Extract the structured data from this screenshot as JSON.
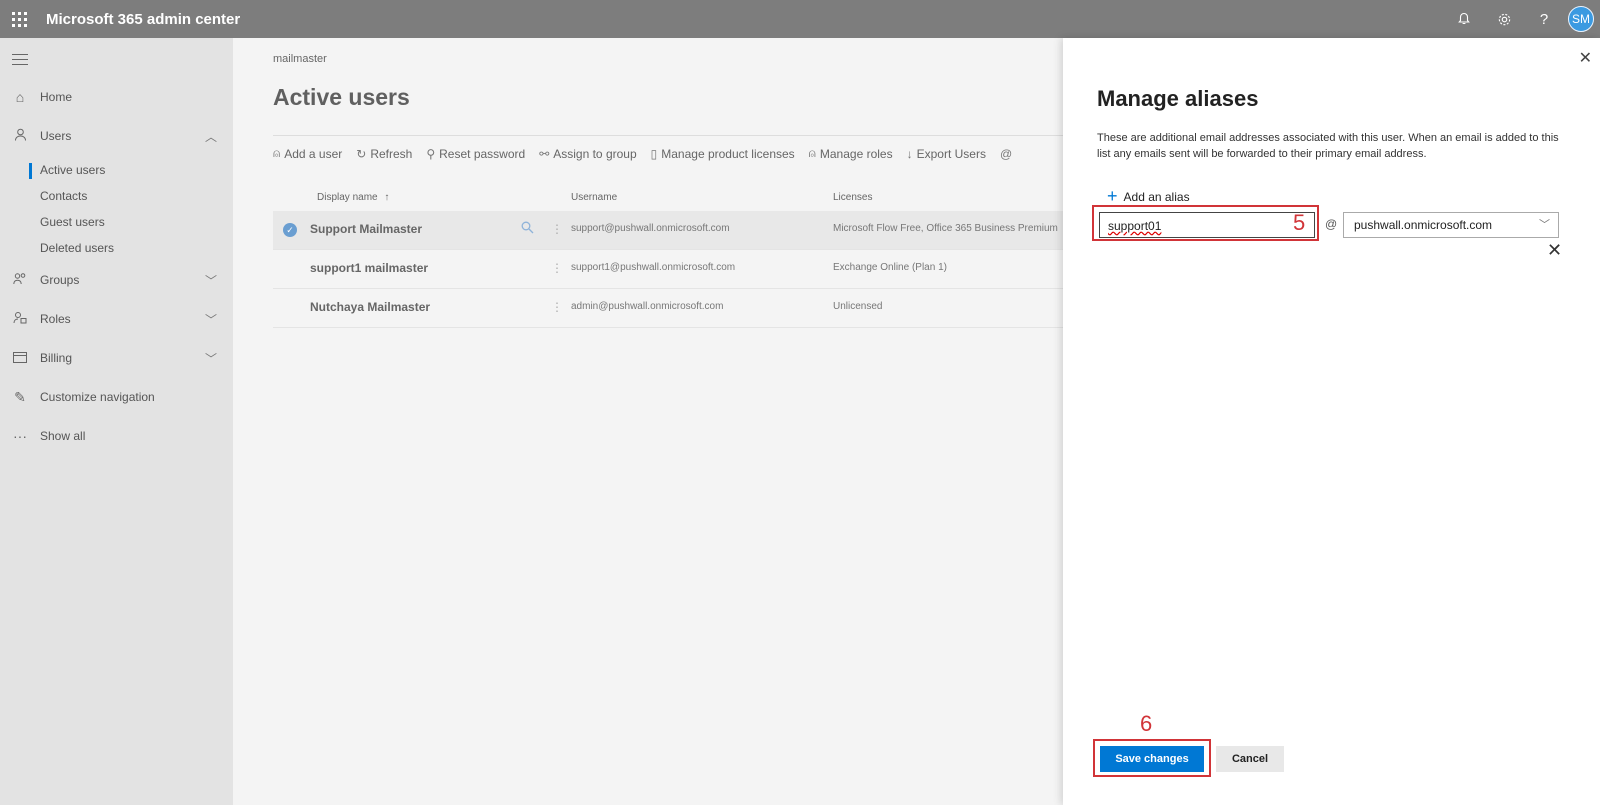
{
  "app": {
    "title": "Microsoft 365 admin center",
    "avatar_initials": "SM"
  },
  "topbar": {
    "icons": [
      "bell-icon",
      "gear-icon",
      "help-icon"
    ]
  },
  "nav": {
    "items": [
      {
        "label": "Home",
        "icon": "home-icon"
      },
      {
        "label": "Users",
        "icon": "user-icon"
      },
      {
        "label": "Groups",
        "icon": "groups-icon"
      },
      {
        "label": "Roles",
        "icon": "roles-icon"
      },
      {
        "label": "Billing",
        "icon": "billing-icon"
      },
      {
        "label": "Customize navigation",
        "icon": "pencil-icon"
      },
      {
        "label": "Show all",
        "icon": "ellipsis-icon"
      }
    ],
    "user_subitems": [
      "Active users",
      "Contacts",
      "Guest users",
      "Deleted users"
    ]
  },
  "main": {
    "breadcrumb": "mailmaster",
    "title": "Active users",
    "toolbar": [
      "Add a user",
      "Refresh",
      "Reset password",
      "Assign to group",
      "Manage product licenses",
      "Manage roles",
      "Export Users"
    ],
    "columns": {
      "display_name": "Display name",
      "sort_indicator": "↑",
      "username": "Username",
      "licenses": "Licenses"
    },
    "rows": [
      {
        "display_name": "Support Mailmaster",
        "username": "support@pushwall.onmicrosoft.com",
        "licenses": "Microsoft Flow Free, Office 365 Business Premium",
        "selected": true
      },
      {
        "display_name": "support1 mailmaster",
        "username": "support1@pushwall.onmicrosoft.com",
        "licenses": "Exchange Online (Plan 1)",
        "selected": false
      },
      {
        "display_name": "Nutchaya Mailmaster",
        "username": "admin@pushwall.onmicrosoft.com",
        "licenses": "Unlicensed",
        "selected": false
      }
    ]
  },
  "panel": {
    "title": "Manage aliases",
    "description": "These are additional email addresses associated with this user. When an email is added to this list any emails sent will be forwarded to their primary email address.",
    "add_alias_label": "Add an alias",
    "alias_value": "support01",
    "at_symbol": "@",
    "domain_value": "pushwall.onmicrosoft.com",
    "save_label": "Save changes",
    "cancel_label": "Cancel",
    "step_labels": {
      "alias": "5",
      "save": "6"
    }
  },
  "colors": {
    "accent": "#0078d4",
    "annotation": "#d13438",
    "topbar": "#7d7d7d"
  }
}
